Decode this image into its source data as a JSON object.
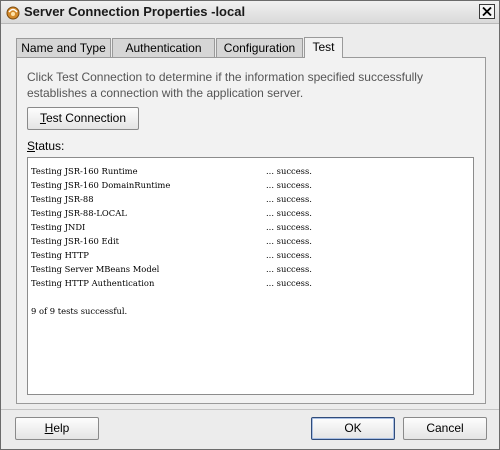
{
  "window": {
    "title": "Server Connection Properties -local",
    "close_label": "close"
  },
  "tabs": [
    {
      "label": "Name and Type",
      "active": false
    },
    {
      "label": "Authentication",
      "active": false
    },
    {
      "label": "Configuration",
      "active": false
    },
    {
      "label": "Test",
      "active": true
    }
  ],
  "test_panel": {
    "description": "Click Test Connection to determine if the information specified successfully establishes a connection with the application server.",
    "test_button": {
      "mnemonic": "T",
      "rest": "est Connection"
    },
    "status_label": {
      "mnemonic": "S",
      "rest": "tatus:"
    },
    "status_lines": [
      {
        "name": "Testing JSR-160 Runtime",
        "result": "... success."
      },
      {
        "name": "Testing JSR-160 DomainRuntime",
        "result": "... success."
      },
      {
        "name": "Testing JSR-88",
        "result": "... success."
      },
      {
        "name": "Testing JSR-88-LOCAL",
        "result": "... success."
      },
      {
        "name": "Testing JNDI",
        "result": "... success."
      },
      {
        "name": "Testing JSR-160 Edit",
        "result": "... success."
      },
      {
        "name": "Testing HTTP",
        "result": "... success."
      },
      {
        "name": "Testing Server MBeans Model",
        "result": "... success."
      },
      {
        "name": "Testing HTTP Authentication",
        "result": "... success."
      }
    ],
    "summary": "9 of 9 tests successful."
  },
  "footer": {
    "help": {
      "mnemonic": "H",
      "rest": "elp"
    },
    "ok": "OK",
    "cancel": "Cancel"
  },
  "colors": {
    "dialog_bg": "#ececec",
    "ok_border": "#2f4b7a",
    "description_text": "#555555"
  },
  "icons": [
    "oracle-jdev-app-icon",
    "close-x-icon"
  ]
}
